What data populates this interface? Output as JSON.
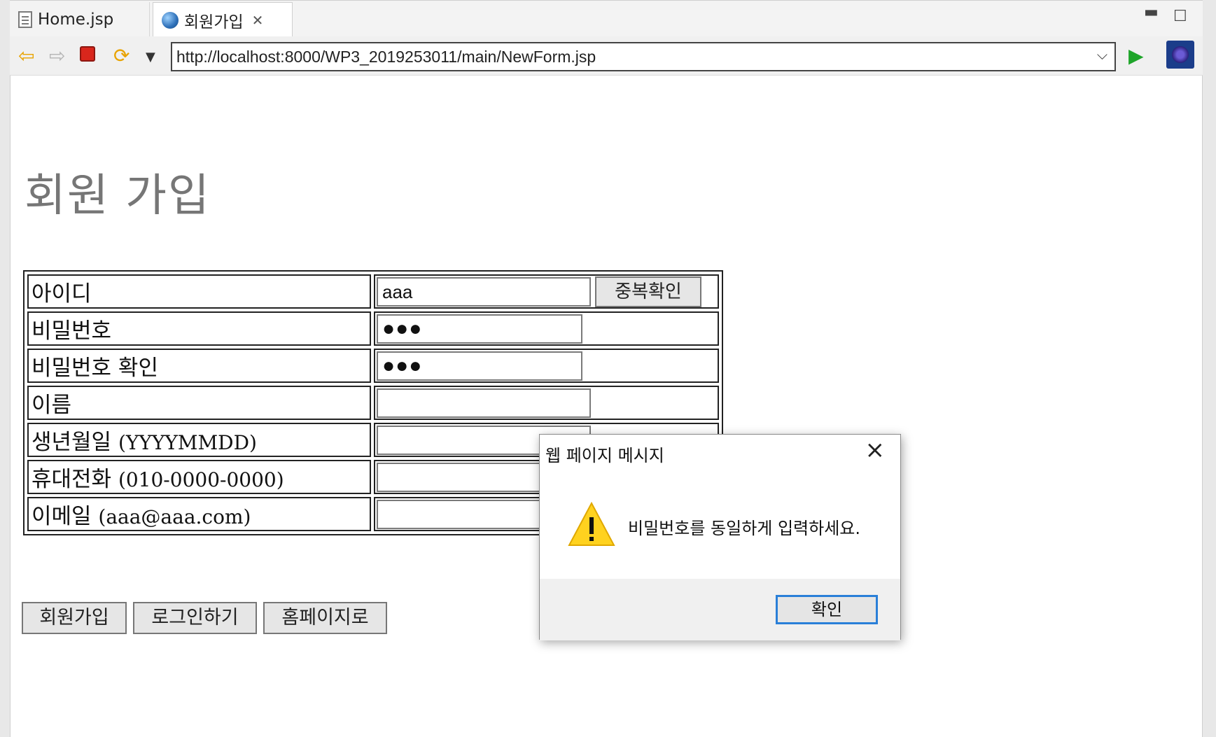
{
  "tabs": [
    {
      "label": "Home.jsp"
    },
    {
      "label": "회원가입"
    }
  ],
  "toolbar": {
    "url": "http://localhost:8000/WP3_2019253011/main/NewForm.jsp"
  },
  "page": {
    "title": "회원 가입",
    "form": {
      "rows": [
        {
          "label": "아이디",
          "paren": "",
          "value": "aaa"
        },
        {
          "label": "비밀번호",
          "paren": "",
          "value": "●●●"
        },
        {
          "label": "비밀번호 확인",
          "paren": "",
          "value": "●●●"
        },
        {
          "label": "이름",
          "paren": "",
          "value": ""
        },
        {
          "label": "생년월일 ",
          "paren": "(YYYYMMDD)",
          "value": ""
        },
        {
          "label": "휴대전화 ",
          "paren": "(010-0000-0000)",
          "value": ""
        },
        {
          "label": "이메일 ",
          "paren": "(aaa@aaa.com)",
          "value": ""
        }
      ],
      "dup_check_label": "중복확인"
    },
    "buttons": {
      "signup": "회원가입",
      "login": "로그인하기",
      "home": "홈페이지로"
    }
  },
  "dialog": {
    "title": "웹 페이지 메시지",
    "message": "비밀번호를 동일하게 입력하세요.",
    "ok_label": "확인"
  },
  "colors": {
    "accent": "#2a7fd8",
    "title_gray": "#767676"
  }
}
